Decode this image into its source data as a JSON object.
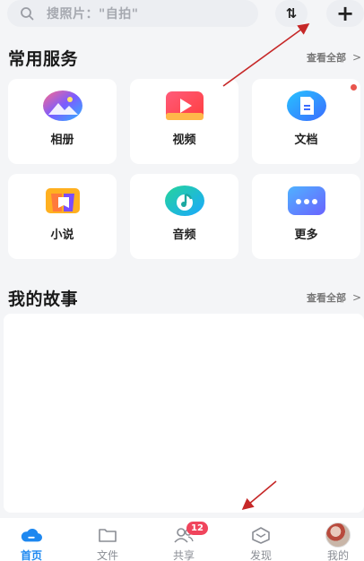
{
  "search": {
    "placeholder": "搜照片：\"自拍\""
  },
  "toolbar": {
    "sort_label": "⇅",
    "add_label": "+"
  },
  "services": {
    "title": "常用服务",
    "view_all": "查看全部",
    "chevron": ">",
    "items": [
      {
        "label": "相册",
        "icon": "album-icon"
      },
      {
        "label": "视频",
        "icon": "video-icon"
      },
      {
        "label": "文档",
        "icon": "document-icon",
        "has_dot": true
      },
      {
        "label": "小说",
        "icon": "novel-icon"
      },
      {
        "label": "音频",
        "icon": "audio-icon"
      },
      {
        "label": "更多",
        "icon": "more-icon"
      }
    ]
  },
  "story": {
    "title": "我的故事",
    "view_all": "查看全部",
    "chevron": ">"
  },
  "tabs": [
    {
      "label": "首页",
      "icon": "cloud-home-icon",
      "active": true
    },
    {
      "label": "文件",
      "icon": "folder-icon"
    },
    {
      "label": "共享",
      "icon": "people-icon",
      "badge": "12"
    },
    {
      "label": "发现",
      "icon": "discover-icon"
    },
    {
      "label": "我的",
      "icon": "avatar"
    }
  ],
  "colors": {
    "accent": "#1e88f0",
    "badge": "#f0445c",
    "annotation_arrow": "#c62828"
  }
}
